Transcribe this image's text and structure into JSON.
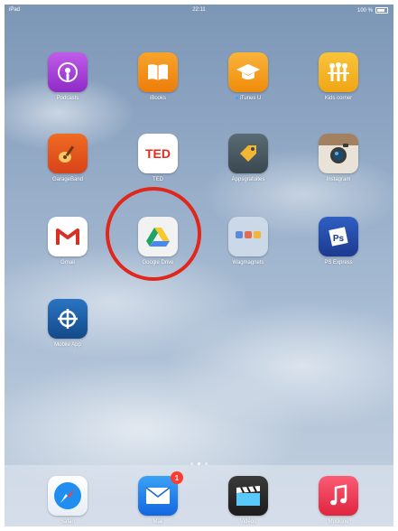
{
  "status_bar": {
    "carrier": "iPad",
    "time": "22:11",
    "battery": "100 %"
  },
  "apps": [
    {
      "id": "podcasts",
      "label": "Podcasts",
      "icon": "podcasts-icon",
      "color": "#b03bd6"
    },
    {
      "id": "books",
      "label": "iBooks",
      "icon": "book-icon",
      "color": "#f5930d"
    },
    {
      "id": "itunes-u",
      "label": "iTunes U",
      "icon": "graduation-cap-icon",
      "color": "#f6a21b",
      "new_indicator": true
    },
    {
      "id": "kids",
      "label": "Kids corner",
      "icon": "children-icon",
      "color": "#f4b21e"
    },
    {
      "id": "garageband",
      "label": "GarageBand",
      "icon": "guitar-icon",
      "color": "#e2561c"
    },
    {
      "id": "ted",
      "label": "TED",
      "icon": "ted-logo-icon",
      "color": "#ffffff"
    },
    {
      "id": "tag",
      "label": "Appsgratuites",
      "icon": "price-tag-icon",
      "color": "#4a5a63"
    },
    {
      "id": "instagram",
      "label": "Instagram",
      "icon": "camera-icon",
      "color": "#8a6a4d"
    },
    {
      "id": "gmail",
      "label": "Gmail",
      "icon": "gmail-icon",
      "color": "#ffffff"
    },
    {
      "id": "google-drive",
      "label": "Google Drive",
      "icon": "google-drive-icon",
      "color": "#f2f2f2"
    },
    {
      "id": "folder",
      "label": "Wagmagnets",
      "icon": "folder-icon",
      "color": "#c9d4e2"
    },
    {
      "id": "ps-express",
      "label": "PS Express",
      "icon": "photoshop-express-icon",
      "color": "#2449a6"
    },
    {
      "id": "mobile-app",
      "label": "Mobile App",
      "icon": "crosshair-icon",
      "color": "#1d5aa8"
    }
  ],
  "dock": [
    {
      "id": "safari",
      "label": "Safari",
      "icon": "compass-icon",
      "color": "#1f8ef0"
    },
    {
      "id": "mail",
      "label": "Mail",
      "icon": "envelope-icon",
      "color": "#1a7ff0",
      "badge": "1"
    },
    {
      "id": "videos",
      "label": "Vidéos",
      "icon": "clapperboard-icon",
      "color": "#2b2b2b"
    },
    {
      "id": "music",
      "label": "Musique",
      "icon": "music-note-icon",
      "color": "#f0344d"
    }
  ],
  "highlight": {
    "target": "google-drive",
    "color": "#e1261c"
  }
}
